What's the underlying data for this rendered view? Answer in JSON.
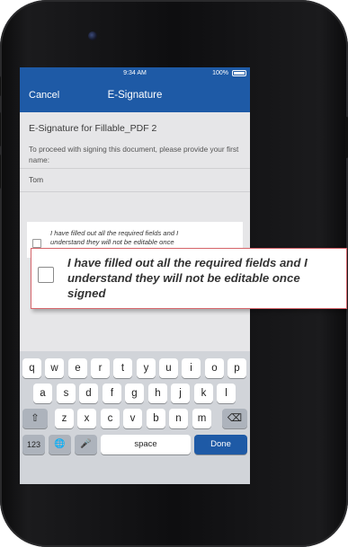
{
  "status": {
    "time": "9:34 AM",
    "battery": "100%"
  },
  "nav": {
    "cancel": "Cancel",
    "title": "E-Signature"
  },
  "doc": {
    "title": "E-Signature for Fillable_PDF 2",
    "prompt": "To proceed with signing this document, please provide your first name:",
    "first_name_value": "Tom"
  },
  "agreement": {
    "text_small": "I have filled out all the required fields and I\nunderstand they will not be editable once",
    "text_zoom": "I have filled out all the required fields and I\nunderstand they will not be editable once\nsigned",
    "checked": false
  },
  "keyboard": {
    "row1": [
      "q",
      "w",
      "e",
      "r",
      "t",
      "y",
      "u",
      "i",
      "o",
      "p"
    ],
    "row2": [
      "a",
      "s",
      "d",
      "f",
      "g",
      "h",
      "j",
      "k",
      "l"
    ],
    "row3": [
      "z",
      "x",
      "c",
      "v",
      "b",
      "n",
      "m"
    ],
    "shift_icon": "⇧",
    "delete_icon": "⌫",
    "numbers": "123",
    "globe_icon": "🌐",
    "mic_icon": "🎤",
    "space": "space",
    "done": "Done"
  },
  "colors": {
    "accent": "#1e5aa6",
    "highlight_border": "#d6656b"
  }
}
